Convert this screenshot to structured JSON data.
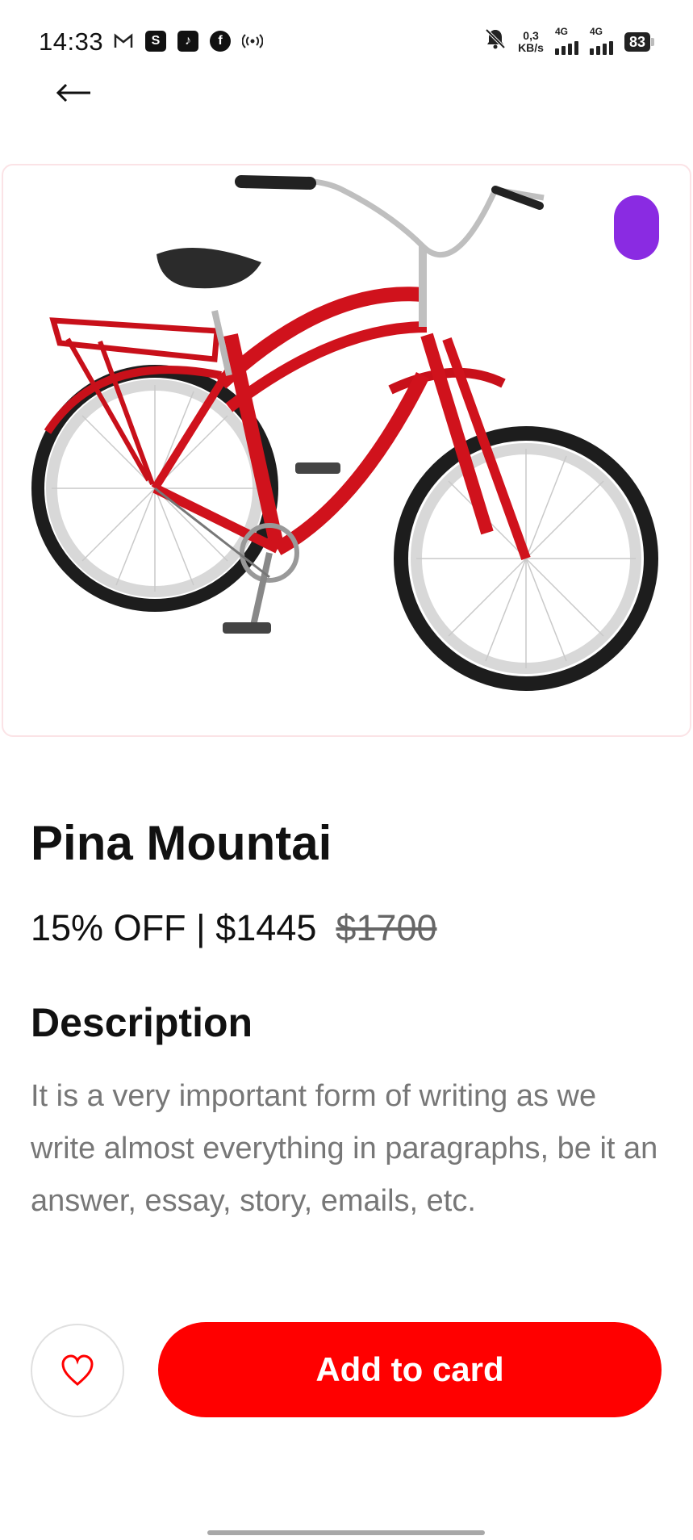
{
  "status_bar": {
    "time": "14:33",
    "network_speed_value": "0,3",
    "network_speed_unit": "KB/s",
    "signal_1_label": "4G",
    "signal_2_label": "4G",
    "battery": "83",
    "left_icons": [
      "gmail-icon",
      "shop-icon",
      "tiktok-icon",
      "facebook-icon",
      "hotspot-icon"
    ],
    "right_icons": [
      "bell-muted-icon",
      "signal-icon",
      "battery-icon"
    ]
  },
  "nav": {
    "back_icon": "arrow-left-icon"
  },
  "product": {
    "image": "red-cruiser-bicycle",
    "selected_color": "#8a2be2",
    "title": "Pina Mountai",
    "discount_price": "15% OFF | $1445",
    "original_price": "$1700"
  },
  "description": {
    "heading": "Description",
    "text": "It is a very important form of writing as we write almost everything in paragraphs, be it an answer, essay, story, emails, etc."
  },
  "actions": {
    "favorite_icon": "heart-outline-icon",
    "add_label": "Add to card"
  },
  "colors": {
    "accent": "#ff0000",
    "swatch": "#8a2be2",
    "muted_text": "#777777"
  }
}
